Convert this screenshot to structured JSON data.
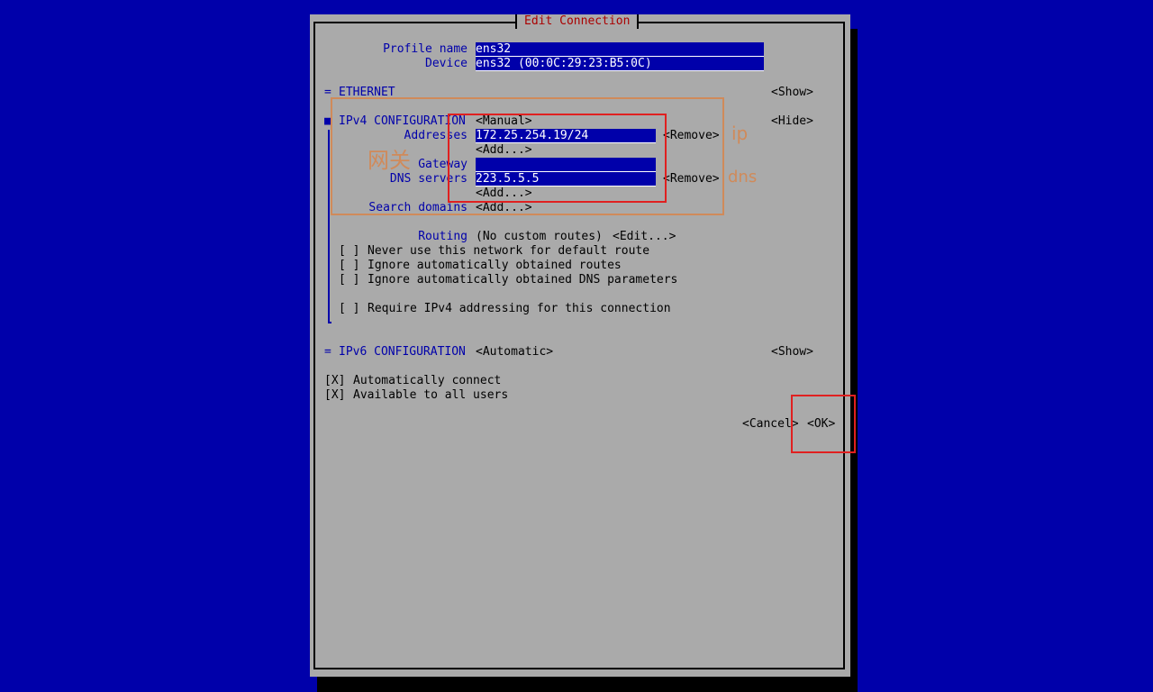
{
  "dialog": {
    "title": "Edit Connection"
  },
  "profile": {
    "label": "Profile name",
    "value": "ens32"
  },
  "device": {
    "label": "Device",
    "value": "ens32 (00:0C:29:23:B5:0C)"
  },
  "ethernet": {
    "marker": "=",
    "label": "ETHERNET",
    "toggle": "<Show>"
  },
  "ipv4": {
    "marker": "■",
    "label": "IPv4 CONFIGURATION",
    "mode": "<Manual>",
    "toggle": "<Hide>",
    "addresses_label": "Addresses",
    "address_value": "172.25.254.19/24",
    "remove": "<Remove>",
    "add": "<Add...>",
    "gateway_label": "Gateway",
    "gateway_value": "",
    "dns_label": "DNS servers",
    "dns_value": "223.5.5.5",
    "search_label": "Search domains",
    "routing_label": "Routing",
    "routing_value": "(No custom routes)",
    "routing_edit": "<Edit...>",
    "checkboxes": [
      {
        "box": "[ ]",
        "text": "Never use this network for default route"
      },
      {
        "box": "[ ]",
        "text": "Ignore automatically obtained routes"
      },
      {
        "box": "[ ]",
        "text": "Ignore automatically obtained DNS parameters"
      },
      {
        "box": "[ ]",
        "text": "Require IPv4 addressing for this connection"
      }
    ]
  },
  "ipv6": {
    "marker": "=",
    "label": "IPv6 CONFIGURATION",
    "mode": "<Automatic>",
    "toggle": "<Show>"
  },
  "options": [
    {
      "box": "[X]",
      "text": "Automatically connect"
    },
    {
      "box": "[X]",
      "text": "Available to all users"
    }
  ],
  "buttons": {
    "cancel": "<Cancel>",
    "ok": "<OK>"
  },
  "annotations": {
    "gateway_cn": "网关",
    "ip": "ip",
    "dns": "dns"
  },
  "colors": {
    "background": "#0000aa",
    "dialog": "#aaaaaa",
    "title": "#aa0000",
    "annotation_orange": "#d08a5a",
    "annotation_red": "#e02020"
  }
}
